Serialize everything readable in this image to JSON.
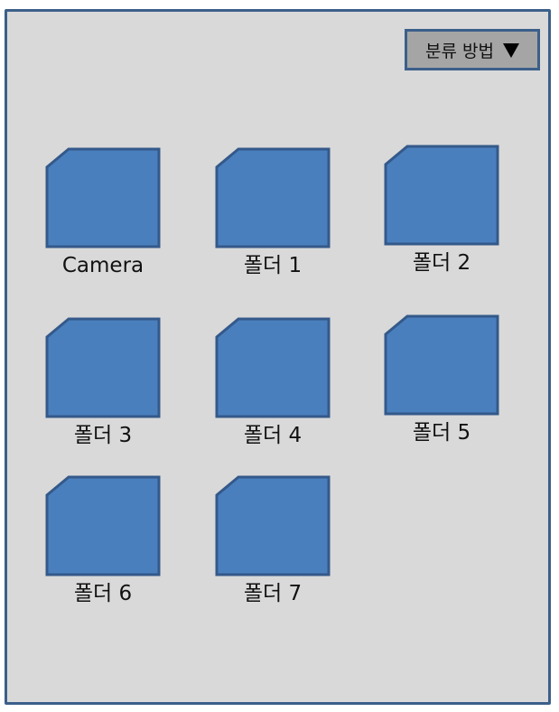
{
  "toolbar": {
    "sort_label": "분류 방법",
    "sort_icon": "triangle-down-icon"
  },
  "folders": [
    {
      "label": "Camera",
      "icon": "folder-icon"
    },
    {
      "label": "폴더 1",
      "icon": "folder-icon"
    },
    {
      "label": "폴더 2",
      "icon": "folder-icon"
    },
    {
      "label": "폴더 3",
      "icon": "folder-icon"
    },
    {
      "label": "폴더 4",
      "icon": "folder-icon"
    },
    {
      "label": "폴더 5",
      "icon": "folder-icon"
    },
    {
      "label": "폴더 6",
      "icon": "folder-icon"
    },
    {
      "label": "폴더 7",
      "icon": "folder-icon"
    }
  ],
  "colors": {
    "folder_fill": "#4a7fbe",
    "folder_stroke": "#34598a",
    "panel_bg": "#d9d9d9",
    "border": "#3c5f8a",
    "button_bg": "#a5a5a5"
  }
}
